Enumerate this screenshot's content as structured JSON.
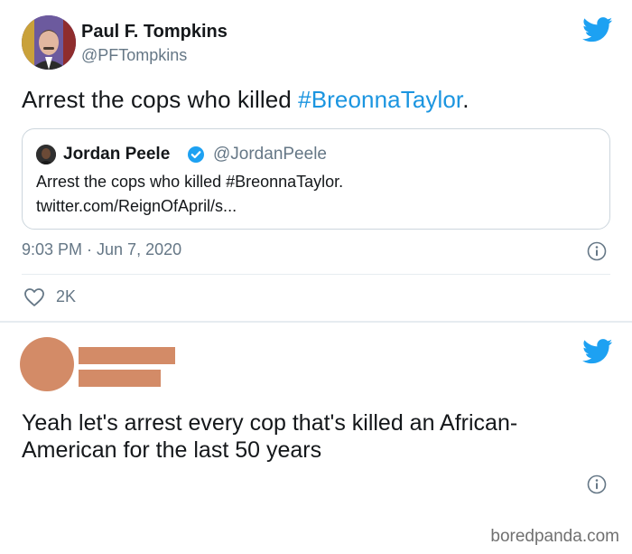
{
  "tweet1": {
    "author": {
      "name": "Paul F. Tompkins",
      "handle": "@PFTompkins"
    },
    "text_prefix": "Arrest the cops who killed ",
    "hashtag": "#BreonnaTaylor",
    "text_suffix": ".",
    "quoted": {
      "name": "Jordan Peele",
      "handle": "@JordanPeele",
      "line1": "Arrest the cops who killed #BreonnaTaylor.",
      "line2": "twitter.com/ReignOfApril/s..."
    },
    "timestamp": "9:03 PM · Jun 7, 2020",
    "likes": "2K"
  },
  "tweet2": {
    "text_line1": "Yeah let's arrest every cop that's killed an African-",
    "text_line2": "American for the last 50 years"
  },
  "watermark": "boredpanda.com",
  "colors": {
    "twitter_blue": "#1da1f2",
    "link": "#1b95e0",
    "redaction": "#d38b67",
    "muted": "#657786"
  }
}
